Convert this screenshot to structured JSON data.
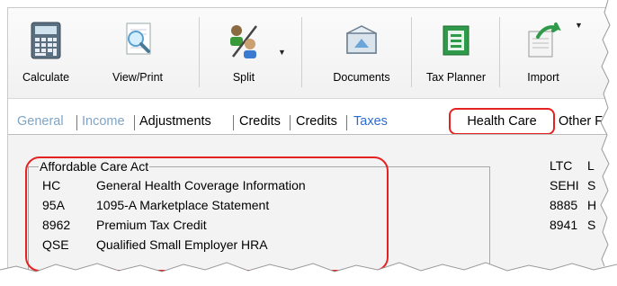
{
  "toolbar": {
    "buttons": [
      {
        "label": "Calculate",
        "icon": "calculator-icon"
      },
      {
        "label": "View/Print",
        "icon": "magnifier-document-icon"
      },
      {
        "label": "Split",
        "icon": "split-people-icon"
      },
      {
        "label": "Documents",
        "icon": "documents-tray-icon"
      },
      {
        "label": "Tax Planner",
        "icon": "tax-planner-icon"
      },
      {
        "label": "Import",
        "icon": "import-icon"
      }
    ]
  },
  "tabs": {
    "general": "General",
    "income": "Income",
    "adjustments": "Adjustments",
    "credits1": "Credits",
    "credits2": "Credits",
    "taxes": "Taxes",
    "health_care": "Health Care",
    "other": "Other F"
  },
  "group": {
    "title": "Affordable Care Act",
    "rows": [
      {
        "code": "HC",
        "desc": "General Health Coverage Information"
      },
      {
        "code": "95A",
        "desc": "1095-A Marketplace Statement"
      },
      {
        "code": "8962",
        "desc": "Premium Tax Credit"
      },
      {
        "code": "QSE",
        "desc": "Qualified Small Employer HRA"
      }
    ]
  },
  "right_col": {
    "rows": [
      {
        "code": "LTC",
        "desc": "L"
      },
      {
        "code": "SEHI",
        "desc": "S"
      },
      {
        "code": "8885",
        "desc": "H"
      },
      {
        "code": "8941",
        "desc": "S"
      }
    ]
  },
  "colors": {
    "highlight": "#e52222",
    "faded_tab": "#7fa4c4",
    "blue_tab": "#2b6bd6"
  }
}
